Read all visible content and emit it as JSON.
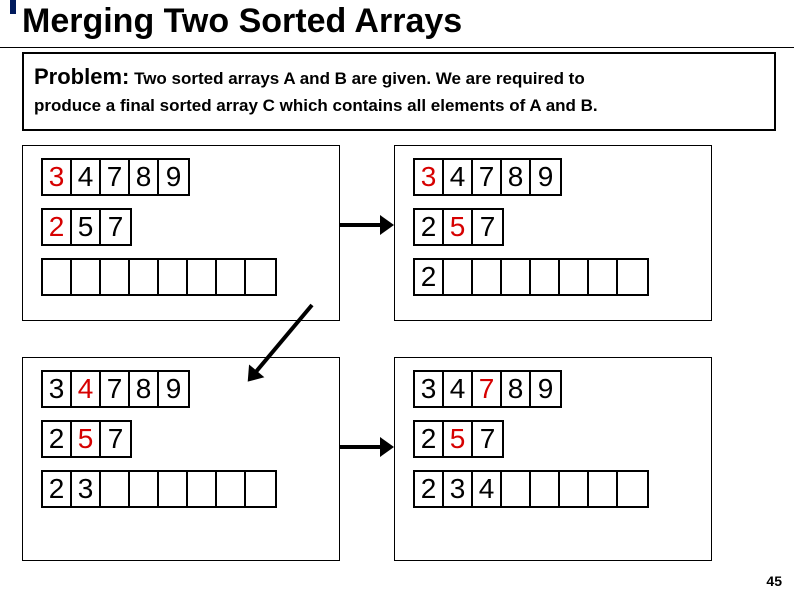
{
  "title": "Merging Two Sorted Arrays",
  "problem": {
    "label": "Problem:",
    "text_line1": " Two sorted arrays A and B are given.  We are required to",
    "text_line2": "produce a final sorted array C which contains all  elements of A and B."
  },
  "page_number": "45",
  "panels": [
    {
      "arrays": [
        {
          "width_cells": 5,
          "values": [
            {
              "v": "3",
              "r": true
            },
            {
              "v": "4"
            },
            {
              "v": "7"
            },
            {
              "v": "8"
            },
            {
              "v": "9"
            }
          ]
        },
        {
          "width_cells": 3,
          "values": [
            {
              "v": "2",
              "r": true
            },
            {
              "v": "5"
            },
            {
              "v": "7"
            }
          ]
        },
        {
          "width_cells": 8,
          "values": []
        }
      ]
    },
    {
      "arrays": [
        {
          "width_cells": 5,
          "values": [
            {
              "v": "3",
              "r": true
            },
            {
              "v": "4"
            },
            {
              "v": "7"
            },
            {
              "v": "8"
            },
            {
              "v": "9"
            }
          ]
        },
        {
          "width_cells": 3,
          "values": [
            {
              "v": "2"
            },
            {
              "v": "5",
              "r": true
            },
            {
              "v": "7"
            }
          ]
        },
        {
          "width_cells": 8,
          "values": [
            {
              "v": "2"
            }
          ]
        }
      ]
    },
    {
      "arrays": [
        {
          "width_cells": 5,
          "values": [
            {
              "v": "3"
            },
            {
              "v": "4",
              "r": true
            },
            {
              "v": "7"
            },
            {
              "v": "8"
            },
            {
              "v": "9"
            }
          ]
        },
        {
          "width_cells": 3,
          "values": [
            {
              "v": "2"
            },
            {
              "v": "5",
              "r": true
            },
            {
              "v": "7"
            }
          ]
        },
        {
          "width_cells": 8,
          "values": [
            {
              "v": "2"
            },
            {
              "v": "3"
            }
          ]
        }
      ]
    },
    {
      "arrays": [
        {
          "width_cells": 5,
          "values": [
            {
              "v": "3"
            },
            {
              "v": "4"
            },
            {
              "v": "7",
              "r": true
            },
            {
              "v": "8"
            },
            {
              "v": "9"
            }
          ]
        },
        {
          "width_cells": 3,
          "values": [
            {
              "v": "2"
            },
            {
              "v": "5",
              "r": true
            },
            {
              "v": "7"
            }
          ]
        },
        {
          "width_cells": 8,
          "values": [
            {
              "v": "2"
            },
            {
              "v": "3"
            },
            {
              "v": "4"
            }
          ]
        }
      ]
    }
  ]
}
